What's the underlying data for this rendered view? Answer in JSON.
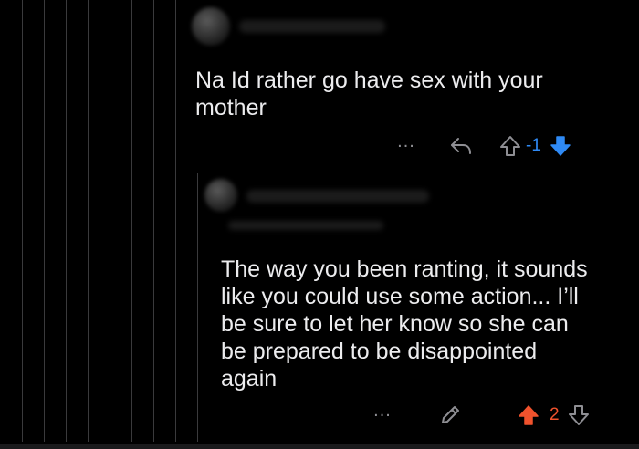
{
  "comment1": {
    "text": "Na Id rather go have sex with your\nmother",
    "more_label": "...",
    "score": "-1",
    "score_color": "#2f8af5",
    "upvote_icon": "arrow-up-outline-icon",
    "downvote_icon": "arrow-down-filled-icon",
    "reply_icon": "reply-arrow-icon"
  },
  "comment2": {
    "text": "The way you been ranting, it sounds\nlike you could use some action... I’ll\nbe sure to let her know so she can\nbe prepared to be disappointed\nagain",
    "more_label": "...",
    "score": "2",
    "score_color": "#f0522d",
    "upvote_icon": "arrow-up-filled-icon",
    "downvote_icon": "arrow-down-outline-icon",
    "edit_icon": "pencil-icon"
  }
}
